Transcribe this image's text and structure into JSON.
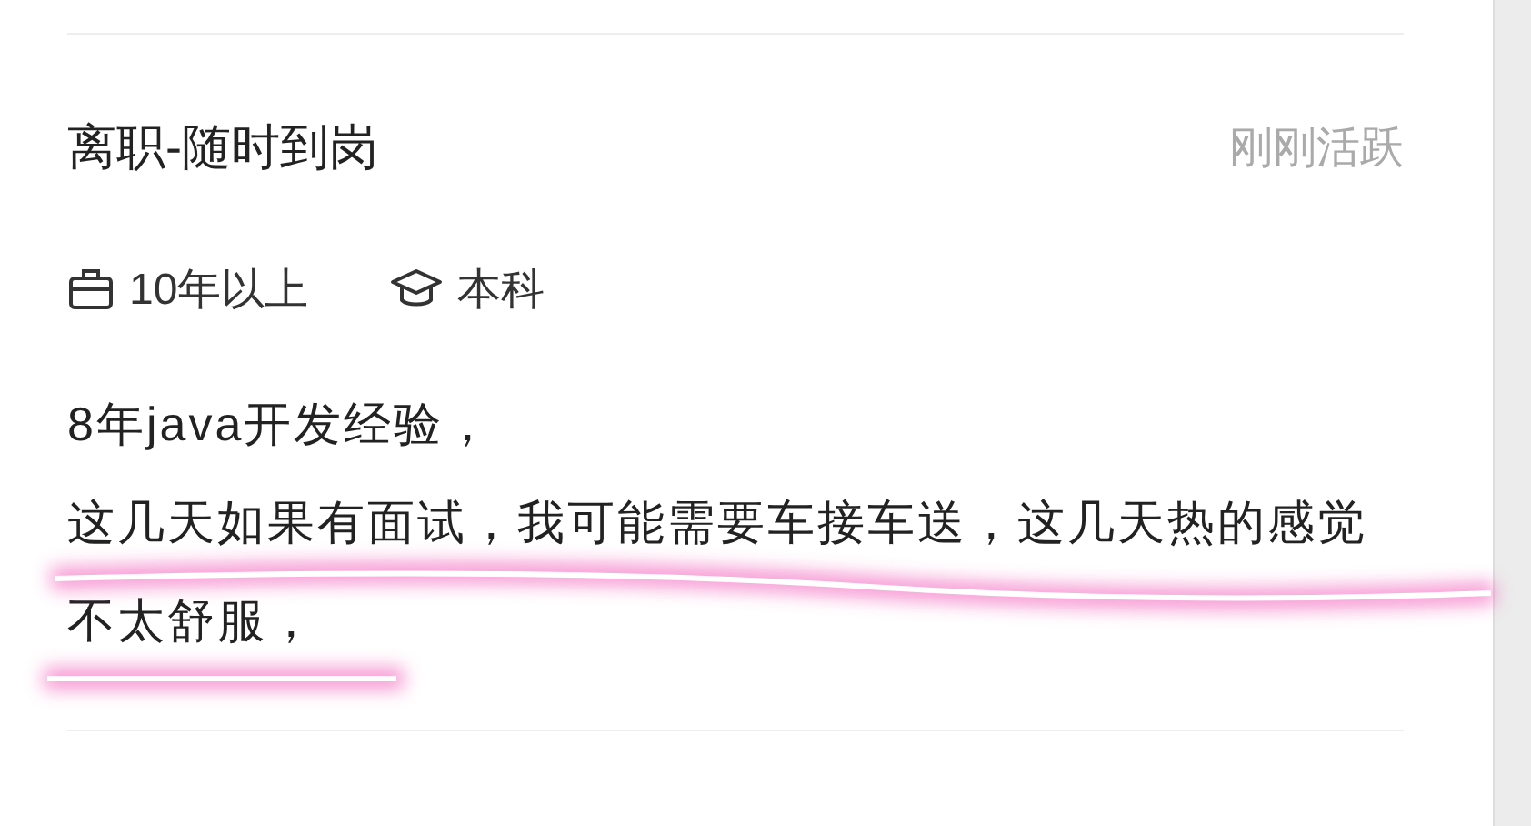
{
  "candidate": {
    "title": "离职-随时到岗",
    "activity": "刚刚活跃",
    "tags": [
      {
        "kind": "experience",
        "label": "10年以上"
      },
      {
        "kind": "education",
        "label": "本科"
      }
    ],
    "description": [
      "8年java开发经验，",
      "这几天如果有面试，我可能需要车接车送，这几天热的感觉",
      "不太舒服，"
    ]
  }
}
